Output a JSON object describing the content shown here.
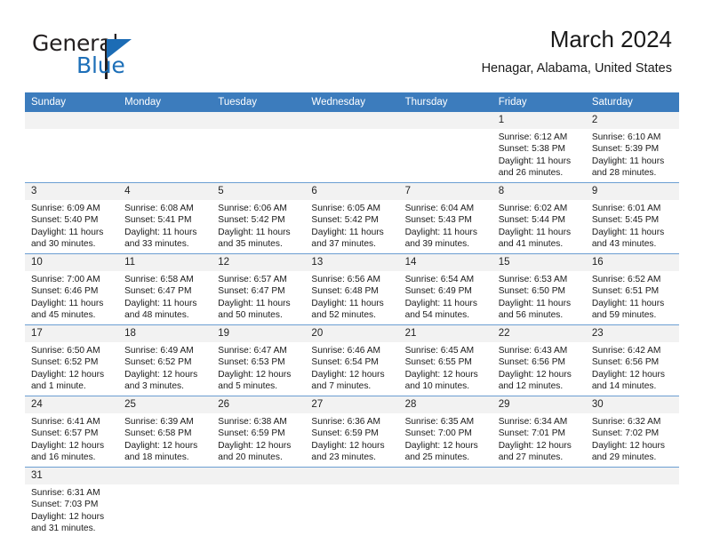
{
  "brand": {
    "name_top": "General",
    "name_bottom": "Blue",
    "accent_color": "#1c6cb5",
    "text_color": "#231f20"
  },
  "header": {
    "month_title": "March 2024",
    "location": "Henagar, Alabama, United States"
  },
  "theme": {
    "header_row_bg": "#3c7cbd",
    "header_row_text": "#ffffff",
    "daynum_bg": "#f2f2f2",
    "grid_line": "#6b9ed2"
  },
  "weekdays": [
    "Sunday",
    "Monday",
    "Tuesday",
    "Wednesday",
    "Thursday",
    "Friday",
    "Saturday"
  ],
  "labels": {
    "sunrise": "Sunrise:",
    "sunset": "Sunset:",
    "daylight": "Daylight:"
  },
  "weeks": [
    [
      {
        "day": "",
        "empty": true,
        "sunrise": "",
        "sunset": "",
        "daylight1": "",
        "daylight2": ""
      },
      {
        "day": "",
        "empty": true,
        "sunrise": "",
        "sunset": "",
        "daylight1": "",
        "daylight2": ""
      },
      {
        "day": "",
        "empty": true,
        "sunrise": "",
        "sunset": "",
        "daylight1": "",
        "daylight2": ""
      },
      {
        "day": "",
        "empty": true,
        "sunrise": "",
        "sunset": "",
        "daylight1": "",
        "daylight2": ""
      },
      {
        "day": "",
        "empty": true,
        "sunrise": "",
        "sunset": "",
        "daylight1": "",
        "daylight2": ""
      },
      {
        "day": "1",
        "empty": false,
        "sunrise": "Sunrise: 6:12 AM",
        "sunset": "Sunset: 5:38 PM",
        "daylight1": "Daylight: 11 hours",
        "daylight2": "and 26 minutes."
      },
      {
        "day": "2",
        "empty": false,
        "sunrise": "Sunrise: 6:10 AM",
        "sunset": "Sunset: 5:39 PM",
        "daylight1": "Daylight: 11 hours",
        "daylight2": "and 28 minutes."
      }
    ],
    [
      {
        "day": "3",
        "empty": false,
        "sunrise": "Sunrise: 6:09 AM",
        "sunset": "Sunset: 5:40 PM",
        "daylight1": "Daylight: 11 hours",
        "daylight2": "and 30 minutes."
      },
      {
        "day": "4",
        "empty": false,
        "sunrise": "Sunrise: 6:08 AM",
        "sunset": "Sunset: 5:41 PM",
        "daylight1": "Daylight: 11 hours",
        "daylight2": "and 33 minutes."
      },
      {
        "day": "5",
        "empty": false,
        "sunrise": "Sunrise: 6:06 AM",
        "sunset": "Sunset: 5:42 PM",
        "daylight1": "Daylight: 11 hours",
        "daylight2": "and 35 minutes."
      },
      {
        "day": "6",
        "empty": false,
        "sunrise": "Sunrise: 6:05 AM",
        "sunset": "Sunset: 5:42 PM",
        "daylight1": "Daylight: 11 hours",
        "daylight2": "and 37 minutes."
      },
      {
        "day": "7",
        "empty": false,
        "sunrise": "Sunrise: 6:04 AM",
        "sunset": "Sunset: 5:43 PM",
        "daylight1": "Daylight: 11 hours",
        "daylight2": "and 39 minutes."
      },
      {
        "day": "8",
        "empty": false,
        "sunrise": "Sunrise: 6:02 AM",
        "sunset": "Sunset: 5:44 PM",
        "daylight1": "Daylight: 11 hours",
        "daylight2": "and 41 minutes."
      },
      {
        "day": "9",
        "empty": false,
        "sunrise": "Sunrise: 6:01 AM",
        "sunset": "Sunset: 5:45 PM",
        "daylight1": "Daylight: 11 hours",
        "daylight2": "and 43 minutes."
      }
    ],
    [
      {
        "day": "10",
        "empty": false,
        "sunrise": "Sunrise: 7:00 AM",
        "sunset": "Sunset: 6:46 PM",
        "daylight1": "Daylight: 11 hours",
        "daylight2": "and 45 minutes."
      },
      {
        "day": "11",
        "empty": false,
        "sunrise": "Sunrise: 6:58 AM",
        "sunset": "Sunset: 6:47 PM",
        "daylight1": "Daylight: 11 hours",
        "daylight2": "and 48 minutes."
      },
      {
        "day": "12",
        "empty": false,
        "sunrise": "Sunrise: 6:57 AM",
        "sunset": "Sunset: 6:47 PM",
        "daylight1": "Daylight: 11 hours",
        "daylight2": "and 50 minutes."
      },
      {
        "day": "13",
        "empty": false,
        "sunrise": "Sunrise: 6:56 AM",
        "sunset": "Sunset: 6:48 PM",
        "daylight1": "Daylight: 11 hours",
        "daylight2": "and 52 minutes."
      },
      {
        "day": "14",
        "empty": false,
        "sunrise": "Sunrise: 6:54 AM",
        "sunset": "Sunset: 6:49 PM",
        "daylight1": "Daylight: 11 hours",
        "daylight2": "and 54 minutes."
      },
      {
        "day": "15",
        "empty": false,
        "sunrise": "Sunrise: 6:53 AM",
        "sunset": "Sunset: 6:50 PM",
        "daylight1": "Daylight: 11 hours",
        "daylight2": "and 56 minutes."
      },
      {
        "day": "16",
        "empty": false,
        "sunrise": "Sunrise: 6:52 AM",
        "sunset": "Sunset: 6:51 PM",
        "daylight1": "Daylight: 11 hours",
        "daylight2": "and 59 minutes."
      }
    ],
    [
      {
        "day": "17",
        "empty": false,
        "sunrise": "Sunrise: 6:50 AM",
        "sunset": "Sunset: 6:52 PM",
        "daylight1": "Daylight: 12 hours",
        "daylight2": "and 1 minute."
      },
      {
        "day": "18",
        "empty": false,
        "sunrise": "Sunrise: 6:49 AM",
        "sunset": "Sunset: 6:52 PM",
        "daylight1": "Daylight: 12 hours",
        "daylight2": "and 3 minutes."
      },
      {
        "day": "19",
        "empty": false,
        "sunrise": "Sunrise: 6:47 AM",
        "sunset": "Sunset: 6:53 PM",
        "daylight1": "Daylight: 12 hours",
        "daylight2": "and 5 minutes."
      },
      {
        "day": "20",
        "empty": false,
        "sunrise": "Sunrise: 6:46 AM",
        "sunset": "Sunset: 6:54 PM",
        "daylight1": "Daylight: 12 hours",
        "daylight2": "and 7 minutes."
      },
      {
        "day": "21",
        "empty": false,
        "sunrise": "Sunrise: 6:45 AM",
        "sunset": "Sunset: 6:55 PM",
        "daylight1": "Daylight: 12 hours",
        "daylight2": "and 10 minutes."
      },
      {
        "day": "22",
        "empty": false,
        "sunrise": "Sunrise: 6:43 AM",
        "sunset": "Sunset: 6:56 PM",
        "daylight1": "Daylight: 12 hours",
        "daylight2": "and 12 minutes."
      },
      {
        "day": "23",
        "empty": false,
        "sunrise": "Sunrise: 6:42 AM",
        "sunset": "Sunset: 6:56 PM",
        "daylight1": "Daylight: 12 hours",
        "daylight2": "and 14 minutes."
      }
    ],
    [
      {
        "day": "24",
        "empty": false,
        "sunrise": "Sunrise: 6:41 AM",
        "sunset": "Sunset: 6:57 PM",
        "daylight1": "Daylight: 12 hours",
        "daylight2": "and 16 minutes."
      },
      {
        "day": "25",
        "empty": false,
        "sunrise": "Sunrise: 6:39 AM",
        "sunset": "Sunset: 6:58 PM",
        "daylight1": "Daylight: 12 hours",
        "daylight2": "and 18 minutes."
      },
      {
        "day": "26",
        "empty": false,
        "sunrise": "Sunrise: 6:38 AM",
        "sunset": "Sunset: 6:59 PM",
        "daylight1": "Daylight: 12 hours",
        "daylight2": "and 20 minutes."
      },
      {
        "day": "27",
        "empty": false,
        "sunrise": "Sunrise: 6:36 AM",
        "sunset": "Sunset: 6:59 PM",
        "daylight1": "Daylight: 12 hours",
        "daylight2": "and 23 minutes."
      },
      {
        "day": "28",
        "empty": false,
        "sunrise": "Sunrise: 6:35 AM",
        "sunset": "Sunset: 7:00 PM",
        "daylight1": "Daylight: 12 hours",
        "daylight2": "and 25 minutes."
      },
      {
        "day": "29",
        "empty": false,
        "sunrise": "Sunrise: 6:34 AM",
        "sunset": "Sunset: 7:01 PM",
        "daylight1": "Daylight: 12 hours",
        "daylight2": "and 27 minutes."
      },
      {
        "day": "30",
        "empty": false,
        "sunrise": "Sunrise: 6:32 AM",
        "sunset": "Sunset: 7:02 PM",
        "daylight1": "Daylight: 12 hours",
        "daylight2": "and 29 minutes."
      }
    ],
    [
      {
        "day": "31",
        "empty": false,
        "sunrise": "Sunrise: 6:31 AM",
        "sunset": "Sunset: 7:03 PM",
        "daylight1": "Daylight: 12 hours",
        "daylight2": "and 31 minutes."
      },
      {
        "day": "",
        "empty": true,
        "sunrise": "",
        "sunset": "",
        "daylight1": "",
        "daylight2": ""
      },
      {
        "day": "",
        "empty": true,
        "sunrise": "",
        "sunset": "",
        "daylight1": "",
        "daylight2": ""
      },
      {
        "day": "",
        "empty": true,
        "sunrise": "",
        "sunset": "",
        "daylight1": "",
        "daylight2": ""
      },
      {
        "day": "",
        "empty": true,
        "sunrise": "",
        "sunset": "",
        "daylight1": "",
        "daylight2": ""
      },
      {
        "day": "",
        "empty": true,
        "sunrise": "",
        "sunset": "",
        "daylight1": "",
        "daylight2": ""
      },
      {
        "day": "",
        "empty": true,
        "sunrise": "",
        "sunset": "",
        "daylight1": "",
        "daylight2": ""
      }
    ]
  ]
}
